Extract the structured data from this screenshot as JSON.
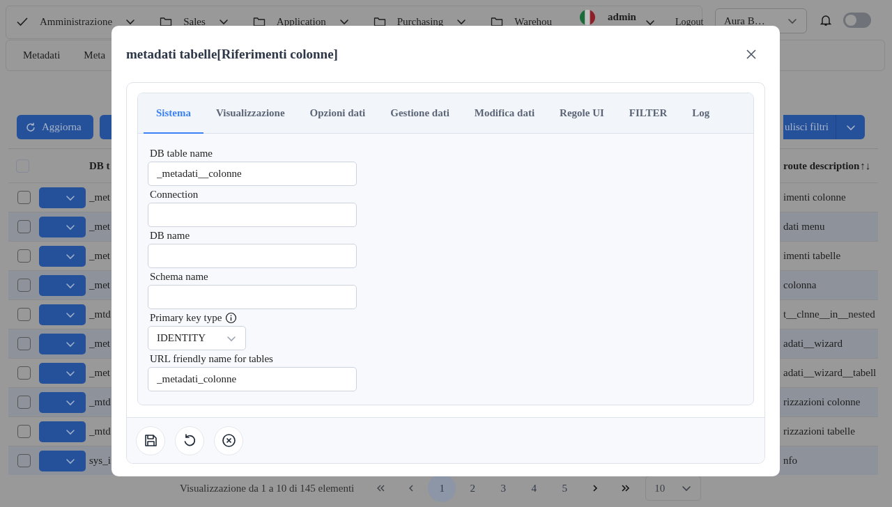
{
  "nav": {
    "menus": [
      {
        "kind": "check",
        "label": "Amministrazione",
        "has_caret": true
      },
      {
        "kind": "folder",
        "label": "Sales",
        "has_caret": true
      },
      {
        "kind": "folder",
        "label": "Application",
        "has_caret": true
      },
      {
        "kind": "folder",
        "label": "Purchasing",
        "has_caret": true
      },
      {
        "kind": "folder",
        "label": "Warehou",
        "has_caret": false
      }
    ],
    "user": {
      "name": "admin"
    },
    "logout": "Logout"
  },
  "company_select": {
    "value": "Aura B…"
  },
  "notifications_toggle": {
    "on": false
  },
  "subnav": {
    "items": [
      {
        "label": "Metadati"
      },
      {
        "label": "Meta"
      }
    ]
  },
  "toolbar": {
    "refresh": "Aggiorna",
    "clear_filters": "ulisci filtri"
  },
  "table": {
    "columns": [
      "DB t",
      "route description"
    ],
    "sort_icon": "↑↓",
    "select_all_checked": false,
    "rows": [
      {
        "column_1": "_met",
        "column_2": "imenti colonne",
        "checked": false
      },
      {
        "column_1": "_met",
        "column_2": "dati menu",
        "checked": false
      },
      {
        "column_1": "_met",
        "column_2": "imenti tabelle",
        "checked": false
      },
      {
        "column_1": "_met",
        "column_2": "colonna",
        "checked": false
      },
      {
        "column_1": "_mtd",
        "column_2": "t__clnne__in__nested",
        "checked": false
      },
      {
        "column_1": "_met",
        "column_2": "adati__wizard",
        "checked": false
      },
      {
        "column_1": "_met",
        "column_2": "adati__wizard__tabell",
        "checked": false
      },
      {
        "column_1": "_mtd",
        "column_2": "rizzazioni colonne",
        "checked": false
      },
      {
        "column_1": "_mtd",
        "column_2": "rizzazioni tabelle",
        "checked": false
      },
      {
        "column_1": "sys_i",
        "column_2": "nfo",
        "checked": false
      }
    ]
  },
  "pagination": {
    "summary": "Visualizzazione da 1 a 10 di 145 elementi",
    "pages": [
      {
        "label": "1",
        "selected": true
      },
      {
        "label": "2",
        "selected": false
      },
      {
        "label": "3",
        "selected": false
      },
      {
        "label": "4",
        "selected": false
      },
      {
        "label": "5",
        "selected": false
      }
    ],
    "page_size": "10"
  },
  "dialog": {
    "title": "metadati tabelle[Riferimenti colonne]",
    "tabs": [
      {
        "label": "Sistema",
        "selected": true
      },
      {
        "label": "Visualizzazione",
        "selected": false
      },
      {
        "label": "Opzioni dati",
        "selected": false
      },
      {
        "label": "Gestione dati",
        "selected": false
      },
      {
        "label": "Modifica dati",
        "selected": false
      },
      {
        "label": "Regole UI",
        "selected": false
      },
      {
        "label": "FILTER",
        "selected": false
      },
      {
        "label": "Log",
        "selected": false
      }
    ],
    "fields": [
      {
        "kind": "text",
        "label": "DB table name",
        "value": "_metadati__colonne",
        "info": false
      },
      {
        "kind": "text",
        "label": "Connection",
        "info": false
      },
      {
        "kind": "text",
        "label": "DB name",
        "info": false
      },
      {
        "kind": "text",
        "label": "Schema name",
        "info": false
      },
      {
        "kind": "select",
        "label": "Primary key type",
        "value": "IDENTITY",
        "info": true
      },
      {
        "kind": "text",
        "label": "URL friendly name for tables",
        "value": "_metadati_colonne",
        "info": false
      }
    ],
    "actions": [
      {
        "kind": "save"
      },
      {
        "kind": "reset"
      },
      {
        "kind": "cancel"
      }
    ]
  }
}
